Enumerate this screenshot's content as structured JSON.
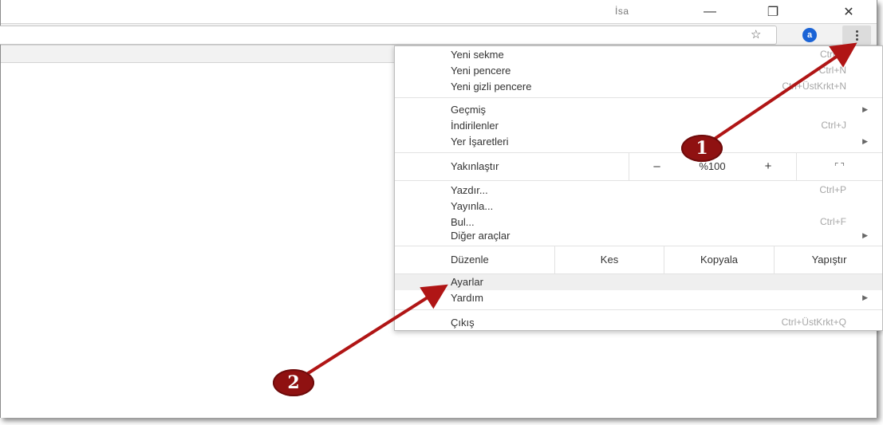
{
  "titlebar": {
    "profile_name": "İsa",
    "minimize_glyph": "—",
    "restore_glyph": "❐",
    "close_glyph": "✕"
  },
  "toolbar": {
    "bookmark_star": "☆",
    "extension_label": "a",
    "extension_color": "#1a63d6"
  },
  "menu": {
    "group1": [
      {
        "label": "Yeni sekme",
        "shortcut": "Ctrl+T"
      },
      {
        "label": "Yeni pencere",
        "shortcut": "Ctrl+N"
      },
      {
        "label": "Yeni gizli pencere",
        "shortcut": "Ctrl+ÜstKrkt+N"
      }
    ],
    "group2": [
      {
        "label": "Geçmiş",
        "shortcut": ""
      },
      {
        "label": "İndirilenler",
        "shortcut": "Ctrl+J"
      },
      {
        "label": "Yer İşaretleri",
        "shortcut": ""
      }
    ],
    "zoom": {
      "label": "Yakınlaştır",
      "minus": "–",
      "value": "%100",
      "plus": "+",
      "fullscreen": "⌜⌝"
    },
    "group3": [
      {
        "label": "Yazdır...",
        "shortcut": "Ctrl+P"
      },
      {
        "label": "Yayınla...",
        "shortcut": ""
      },
      {
        "label": "Bul...",
        "shortcut": "Ctrl+F"
      },
      {
        "label": "Diğer araçlar",
        "shortcut": ""
      }
    ],
    "edit": {
      "label": "Düzenle",
      "cut": "Kes",
      "copy": "Kopyala",
      "paste": "Yapıştır"
    },
    "group4": [
      {
        "label": "Ayarlar",
        "shortcut": ""
      },
      {
        "label": "Yardım",
        "shortcut": ""
      }
    ],
    "exit": {
      "label": "Çıkış",
      "shortcut": "Ctrl+ÜstKrkt+Q"
    },
    "submenu_arrow": "▶"
  },
  "annotations": {
    "badge1": "1",
    "badge2": "2",
    "arrow_color": "#b01515"
  }
}
